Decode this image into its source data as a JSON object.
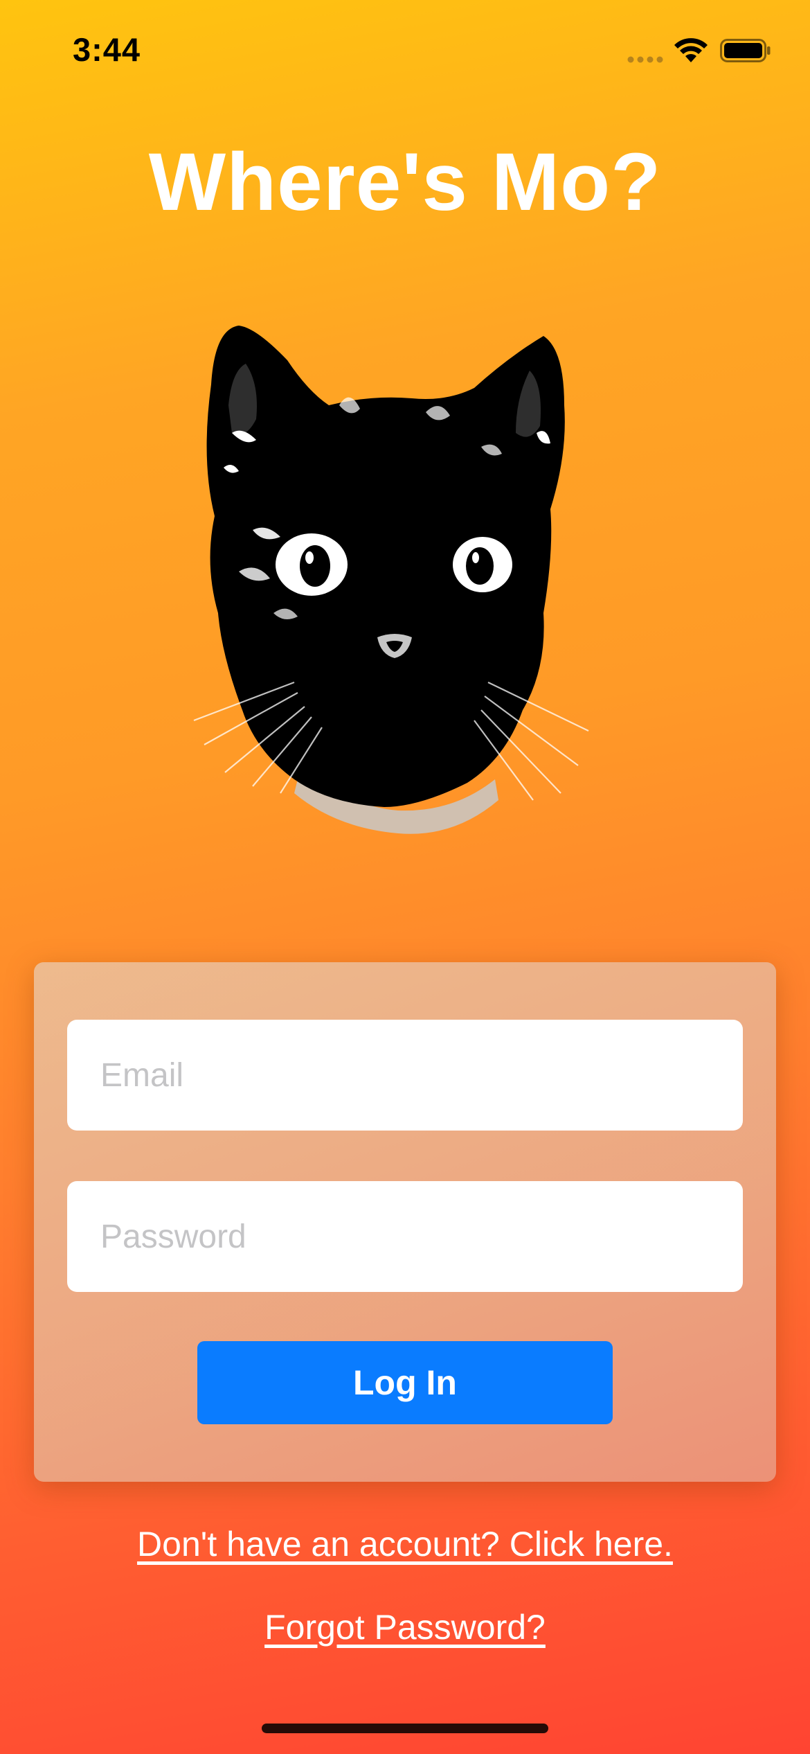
{
  "status_bar": {
    "time": "3:44",
    "icons": [
      "signal-icon",
      "wifi-icon",
      "battery-icon"
    ]
  },
  "header": {
    "title": "Where's Mo?"
  },
  "logo": {
    "icon": "cat-head-icon"
  },
  "login": {
    "email_placeholder": "Email",
    "email_value": "",
    "password_placeholder": "Password",
    "password_value": "",
    "login_button_label": "Log In"
  },
  "links": {
    "signup": "Don't have an account? Click here.",
    "forgot_password": "Forgot Password?"
  },
  "colors": {
    "gradient_top": "#FFC40F",
    "gradient_bottom": "#FF4432",
    "button_blue": "#0A7CFF",
    "title_white": "#FFFFFF"
  }
}
